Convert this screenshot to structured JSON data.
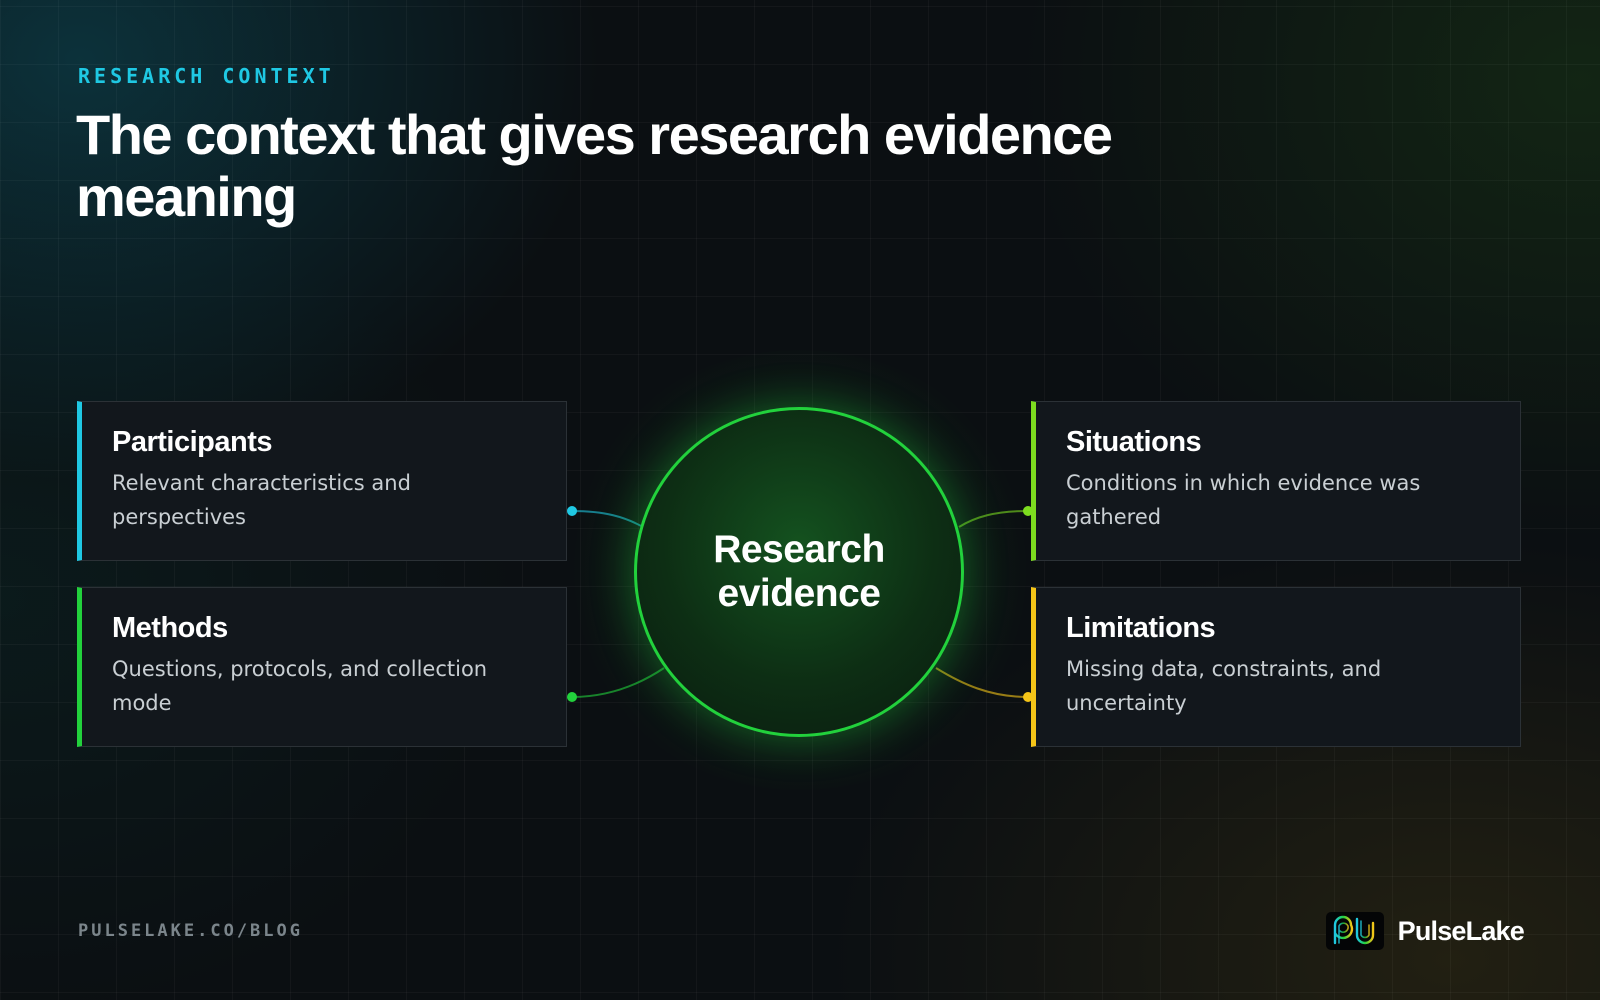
{
  "eyebrow": "RESEARCH CONTEXT",
  "title": "The context that gives research evidence meaning",
  "hub": {
    "label": "Research evidence",
    "color": "#22d13c"
  },
  "cards": [
    {
      "id": "participants",
      "title": "Participants",
      "description": "Relevant characteristics and perspectives",
      "accent": "#1fc8e3"
    },
    {
      "id": "methods",
      "title": "Methods",
      "description": "Questions, protocols, and collection mode",
      "accent": "#22d13c"
    },
    {
      "id": "situations",
      "title": "Situations",
      "description": "Conditions in which evidence was gathered",
      "accent": "#7ddc1f"
    },
    {
      "id": "limitations",
      "title": "Limitations",
      "description": "Missing data, constraints, and uncertainty",
      "accent": "#f5c518"
    }
  ],
  "footer": {
    "url": "PULSELAKE.CO/BLOG",
    "brand_name": "PulseLake",
    "brand_icon": "pulselake-logo-icon"
  }
}
